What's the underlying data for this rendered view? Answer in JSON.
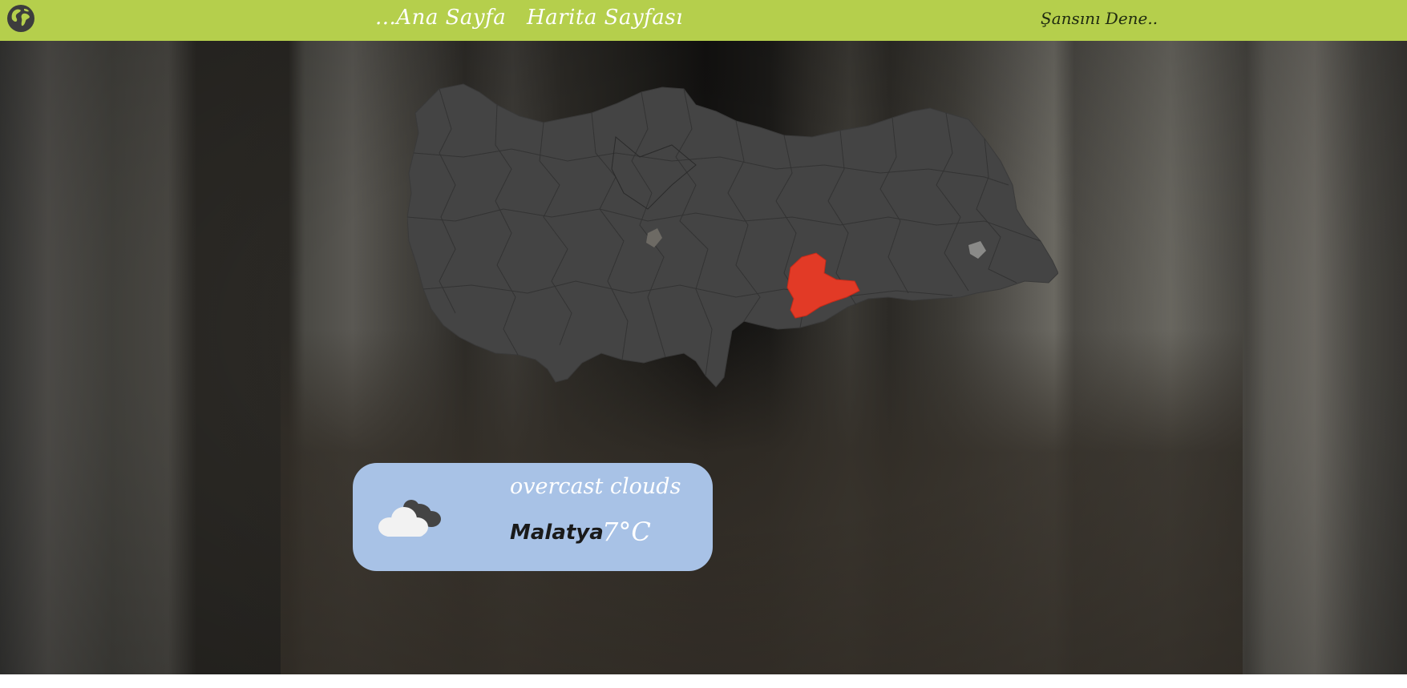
{
  "nav": {
    "logo_icon": "globe-icon",
    "home_label": "...Ana Sayfa",
    "map_label": "Harita Sayfası",
    "luck_label": "Şansını Dene.."
  },
  "map": {
    "highlighted_province": "Malatya",
    "base_color": "#444444",
    "highlight_color": "#e23a26"
  },
  "weather": {
    "icon": "cloud-icon",
    "description": "overcast clouds",
    "city": "Malatya",
    "temperature": "7°C"
  },
  "colors": {
    "topbar": "#b5cf4c",
    "card": "#a8c2e6"
  }
}
